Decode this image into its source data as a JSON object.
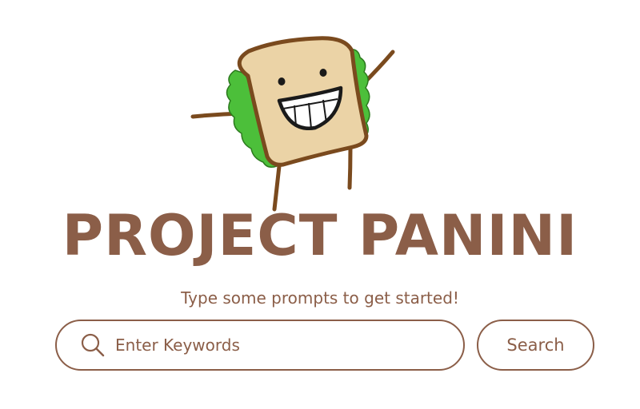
{
  "brand": {
    "title": "PROJECT PANINI",
    "mascot_icon": "sandwich-mascot-icon"
  },
  "prompt": {
    "subtitle": "Type some prompts to get started!"
  },
  "search": {
    "placeholder": "Enter Keywords",
    "value": "",
    "icon": "search-icon",
    "button_label": "Search"
  },
  "colors": {
    "primary_brown": "#8B5E48",
    "bread": "#EBD3A6",
    "crust": "#7A4A1E",
    "lettuce": "#4CBF3A",
    "background": "#FFFFFF"
  }
}
